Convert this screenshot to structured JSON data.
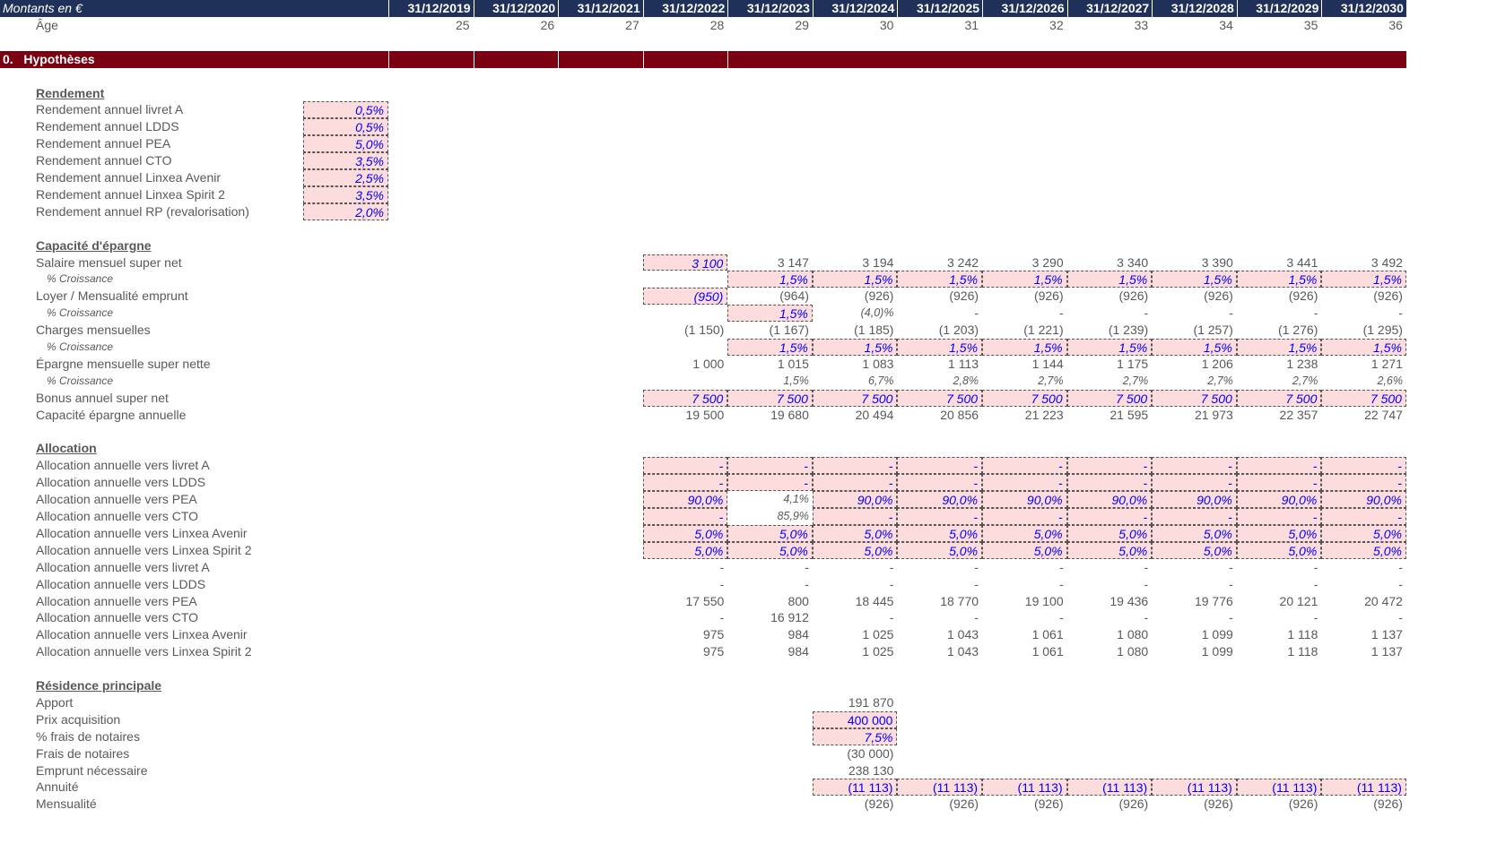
{
  "header": {
    "title": "Montants en €",
    "years": [
      "31/12/2019",
      "31/12/2020",
      "31/12/2021",
      "31/12/2022",
      "31/12/2023",
      "31/12/2024",
      "31/12/2025",
      "31/12/2026",
      "31/12/2027",
      "31/12/2028",
      "31/12/2029",
      "31/12/2030"
    ]
  },
  "age": {
    "label": "Âge",
    "values": [
      "25",
      "26",
      "27",
      "28",
      "29",
      "30",
      "31",
      "32",
      "33",
      "34",
      "35",
      "36"
    ]
  },
  "section": {
    "number": "0.",
    "title": "Hypothèses"
  },
  "colors": {
    "header_bg": "#1f3158",
    "section_bg": "#7b0011",
    "input_bg": "#fcdcdc",
    "input_text": "#0000ff"
  },
  "rows": [
    {
      "r": 5,
      "label": "Rendement",
      "type": "sec"
    },
    {
      "r": 6,
      "label": "Rendement annuel livret A",
      "pre": {
        "v": "0,5%",
        "s": "in"
      }
    },
    {
      "r": 7,
      "label": "Rendement annuel LDDS",
      "pre": {
        "v": "0,5%",
        "s": "in"
      }
    },
    {
      "r": 8,
      "label": "Rendement annuel PEA",
      "pre": {
        "v": "5,0%",
        "s": "in"
      }
    },
    {
      "r": 9,
      "label": "Rendement annuel CTO",
      "pre": {
        "v": "3,5%",
        "s": "in"
      }
    },
    {
      "r": 10,
      "label": "Rendement annuel Linxea Avenir",
      "pre": {
        "v": "2,5%",
        "s": "in"
      }
    },
    {
      "r": 11,
      "label": "Rendement annuel Linxea Spirit 2",
      "pre": {
        "v": "3,5%",
        "s": "in"
      }
    },
    {
      "r": 12,
      "label": "Rendement annuel RP (revalorisation)",
      "pre": {
        "v": "2,0%",
        "s": "in"
      }
    },
    {
      "r": 14,
      "label": "Capacité d'épargne",
      "type": "sec"
    },
    {
      "r": 15,
      "label": "Salaire mensuel super net",
      "start": 3,
      "s": [
        "in",
        "c"
      ],
      "cells": [
        "3 100",
        "3 147",
        "3 194",
        "3 242",
        "3 290",
        "3 340",
        "3 390",
        "3 441",
        "3 492"
      ]
    },
    {
      "r": 16,
      "label": "% Croissance",
      "type": "sub",
      "start": 4,
      "s": [
        "in"
      ],
      "cells": [
        "1,5%",
        "1,5%",
        "1,5%",
        "1,5%",
        "1,5%",
        "1,5%",
        "1,5%",
        "1,5%"
      ]
    },
    {
      "r": 17,
      "label": "Loyer / Mensualité emprunt",
      "start": 3,
      "s": [
        "in",
        "c"
      ],
      "cells": [
        "(950)",
        "(964)",
        "(926)",
        "(926)",
        "(926)",
        "(926)",
        "(926)",
        "(926)",
        "(926)"
      ]
    },
    {
      "r": 18,
      "label": "% Croissance",
      "type": "sub",
      "start": 4,
      "s": [
        "in",
        "ci",
        "c"
      ],
      "cells": [
        "1,5%",
        "(4,0)%",
        "-",
        "-",
        "-",
        "-",
        "-",
        "-"
      ]
    },
    {
      "r": 19,
      "label": "Charges mensuelles",
      "start": 3,
      "s": [
        "c"
      ],
      "cells": [
        "(1 150)",
        "(1 167)",
        "(1 185)",
        "(1 203)",
        "(1 221)",
        "(1 239)",
        "(1 257)",
        "(1 276)",
        "(1 295)"
      ]
    },
    {
      "r": 20,
      "label": "% Croissance",
      "type": "sub",
      "start": 4,
      "s": [
        "in"
      ],
      "cells": [
        "1,5%",
        "1,5%",
        "1,5%",
        "1,5%",
        "1,5%",
        "1,5%",
        "1,5%",
        "1,5%"
      ]
    },
    {
      "r": 21,
      "label": "Épargne mensuelle super nette",
      "start": 3,
      "s": [
        "c"
      ],
      "cells": [
        "1 000",
        "1 015",
        "1 083",
        "1 113",
        "1 144",
        "1 175",
        "1 206",
        "1 238",
        "1 271"
      ]
    },
    {
      "r": 22,
      "label": "% Croissance",
      "type": "sub",
      "start": 4,
      "s": [
        "ci"
      ],
      "cells": [
        "1,5%",
        "6,7%",
        "2,8%",
        "2,7%",
        "2,7%",
        "2,7%",
        "2,7%",
        "2,6%"
      ]
    },
    {
      "r": 23,
      "label": "Bonus annuel super net",
      "start": 3,
      "s": [
        "in"
      ],
      "cells": [
        "7 500",
        "7 500",
        "7 500",
        "7 500",
        "7 500",
        "7 500",
        "7 500",
        "7 500",
        "7 500"
      ]
    },
    {
      "r": 24,
      "label": "Capacité épargne annuelle",
      "start": 3,
      "s": [
        "c"
      ],
      "cells": [
        "19 500",
        "19 680",
        "20 494",
        "20 856",
        "21 223",
        "21 595",
        "21 973",
        "22 357",
        "22 747"
      ]
    },
    {
      "r": 26,
      "label": "Allocation",
      "type": "sec"
    },
    {
      "r": 27,
      "label": "Allocation annuelle vers livret A",
      "start": 3,
      "s": [
        "in"
      ],
      "cells": [
        "-",
        "-",
        "-",
        "-",
        "-",
        "-",
        "-",
        "-",
        "-"
      ]
    },
    {
      "r": 28,
      "label": "Allocation annuelle vers LDDS",
      "start": 3,
      "s": [
        "in"
      ],
      "cells": [
        "-",
        "-",
        "-",
        "-",
        "-",
        "-",
        "-",
        "-",
        "-"
      ]
    },
    {
      "r": 29,
      "label": "Allocation annuelle vers PEA",
      "start": 3,
      "s": [
        "in",
        "ci",
        "in"
      ],
      "cells": [
        "90,0%",
        "4,1%",
        "90,0%",
        "90,0%",
        "90,0%",
        "90,0%",
        "90,0%",
        "90,0%",
        "90,0%"
      ]
    },
    {
      "r": 30,
      "label": "Allocation annuelle vers CTO",
      "start": 3,
      "s": [
        "in",
        "ci",
        "in"
      ],
      "cells": [
        "-",
        "85,9%",
        "-",
        "-",
        "-",
        "-",
        "-",
        "-",
        "-"
      ]
    },
    {
      "r": 31,
      "label": "Allocation annuelle vers Linxea Avenir",
      "start": 3,
      "s": [
        "in"
      ],
      "cells": [
        "5,0%",
        "5,0%",
        "5,0%",
        "5,0%",
        "5,0%",
        "5,0%",
        "5,0%",
        "5,0%",
        "5,0%"
      ]
    },
    {
      "r": 32,
      "label": "Allocation annuelle vers Linxea Spirit 2",
      "start": 3,
      "s": [
        "in"
      ],
      "cells": [
        "5,0%",
        "5,0%",
        "5,0%",
        "5,0%",
        "5,0%",
        "5,0%",
        "5,0%",
        "5,0%",
        "5,0%"
      ]
    },
    {
      "r": 33,
      "label": "Allocation annuelle vers livret A",
      "start": 3,
      "s": [
        "c"
      ],
      "cells": [
        "-",
        "-",
        "-",
        "-",
        "-",
        "-",
        "-",
        "-",
        "-"
      ]
    },
    {
      "r": 34,
      "label": "Allocation annuelle vers LDDS",
      "start": 3,
      "s": [
        "c"
      ],
      "cells": [
        "-",
        "-",
        "-",
        "-",
        "-",
        "-",
        "-",
        "-",
        "-"
      ]
    },
    {
      "r": 35,
      "label": "Allocation annuelle vers PEA",
      "start": 3,
      "s": [
        "c"
      ],
      "cells": [
        "17 550",
        "800",
        "18 445",
        "18 770",
        "19 100",
        "19 436",
        "19 776",
        "20 121",
        "20 472"
      ]
    },
    {
      "r": 36,
      "label": "Allocation annuelle vers CTO",
      "start": 3,
      "s": [
        "c"
      ],
      "cells": [
        "-",
        "16 912",
        "-",
        "-",
        "-",
        "-",
        "-",
        "-",
        "-"
      ]
    },
    {
      "r": 37,
      "label": "Allocation annuelle vers Linxea Avenir",
      "start": 3,
      "s": [
        "c"
      ],
      "cells": [
        "975",
        "984",
        "1 025",
        "1 043",
        "1 061",
        "1 080",
        "1 099",
        "1 118",
        "1 137"
      ]
    },
    {
      "r": 38,
      "label": "Allocation annuelle vers Linxea Spirit 2",
      "start": 3,
      "s": [
        "c"
      ],
      "cells": [
        "975",
        "984",
        "1 025",
        "1 043",
        "1 061",
        "1 080",
        "1 099",
        "1 118",
        "1 137"
      ]
    },
    {
      "r": 40,
      "label": "Résidence principale",
      "type": "sec"
    },
    {
      "r": 41,
      "label": "Apport",
      "start": 5,
      "s": [
        "c"
      ],
      "cells": [
        "191 870"
      ]
    },
    {
      "r": 42,
      "label": "Prix acquisition",
      "start": 5,
      "s": [
        "inb"
      ],
      "cells": [
        "400 000"
      ]
    },
    {
      "r": 43,
      "label": "% frais de notaires",
      "start": 5,
      "s": [
        "in"
      ],
      "cells": [
        "7,5%"
      ]
    },
    {
      "r": 44,
      "label": "Frais de notaires",
      "start": 5,
      "s": [
        "c"
      ],
      "cells": [
        "(30 000)"
      ]
    },
    {
      "r": 45,
      "label": "Emprunt nécessaire",
      "start": 5,
      "s": [
        "c"
      ],
      "cells": [
        "238 130"
      ]
    },
    {
      "r": 46,
      "label": "Annuité",
      "start": 5,
      "s": [
        "inb"
      ],
      "cells": [
        "(11 113)",
        "(11 113)",
        "(11 113)",
        "(11 113)",
        "(11 113)",
        "(11 113)",
        "(11 113)"
      ]
    },
    {
      "r": 47,
      "label": "Mensualité",
      "start": 5,
      "s": [
        "c"
      ],
      "cells": [
        "(926)",
        "(926)",
        "(926)",
        "(926)",
        "(926)",
        "(926)",
        "(926)"
      ]
    }
  ]
}
